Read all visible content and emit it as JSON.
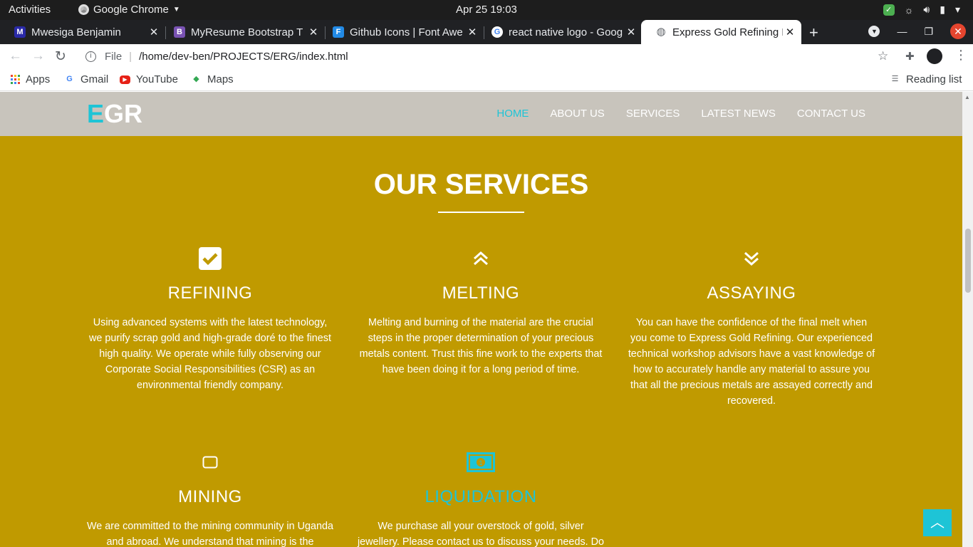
{
  "system": {
    "activities": "Activities",
    "app_name": "Google Chrome",
    "clock": "Apr 25  19:03"
  },
  "tabs": [
    {
      "title": "Mwesiga Benjamin",
      "favicon": "M",
      "color": "#3f3fbf"
    },
    {
      "title": "MyResume Bootstrap T",
      "favicon": "B",
      "color": "#7952b3"
    },
    {
      "title": "Github Icons | Font Awe",
      "favicon": "F",
      "color": "#228ae6"
    },
    {
      "title": "react native logo - Goog",
      "favicon": "G",
      "color": "#ffffff"
    },
    {
      "title": "Express Gold Refining L",
      "favicon": "◍",
      "color": "#5f6368"
    }
  ],
  "address": {
    "scheme": "File",
    "url": "/home/dev-ben/PROJECTS/ERG/index.html"
  },
  "bookmarks": [
    {
      "label": "Apps",
      "icon": "apps-grid-icon"
    },
    {
      "label": "Gmail",
      "icon": "google-icon"
    },
    {
      "label": "YouTube",
      "icon": "youtube-icon"
    },
    {
      "label": "Maps",
      "icon": "maps-icon"
    }
  ],
  "reading_list": "Reading list",
  "site": {
    "logo_first": "E",
    "logo_rest": "GR",
    "nav": [
      "HOME",
      "ABOUT US",
      "SERVICES",
      "LATEST NEWS",
      "CONTACT US"
    ],
    "section_title": "OUR SERVICES",
    "services": [
      {
        "title": "REFINING",
        "icon": "checkbox-icon",
        "text": "Using advanced systems with the latest technology, we purify scrap gold and high-grade doré to the finest high quality. We operate while fully observing our Corporate Social Responsibilities (CSR) as an environmental friendly company."
      },
      {
        "title": "MELTING",
        "icon": "double-chevron-up-icon",
        "text": "Melting and burning of the material are the crucial steps in the proper determination of your precious metals content. Trust this fine work to the experts that have been doing it for a long period of time."
      },
      {
        "title": "ASSAYING",
        "icon": "double-chevron-down-icon",
        "text": "You can have the confidence of the final melt when you come to Express Gold Refining. Our experienced technical workshop advisors have a vast knowledge of how to accurately handle any material to assure you that all the precious metals are assayed correctly and recovered."
      },
      {
        "title": "MINING",
        "icon": "square-icon",
        "text": "We are committed to the mining community in Uganda and abroad. We understand that mining is the backbone"
      },
      {
        "title": "LIQUIDATION",
        "icon": "money-bill-icon",
        "text": "We purchase all your overstock of gold, silver jewellery. Please contact us to discuss your needs. Do you have"
      }
    ],
    "accent": "#1ec4d6",
    "background": "#c09a00"
  }
}
